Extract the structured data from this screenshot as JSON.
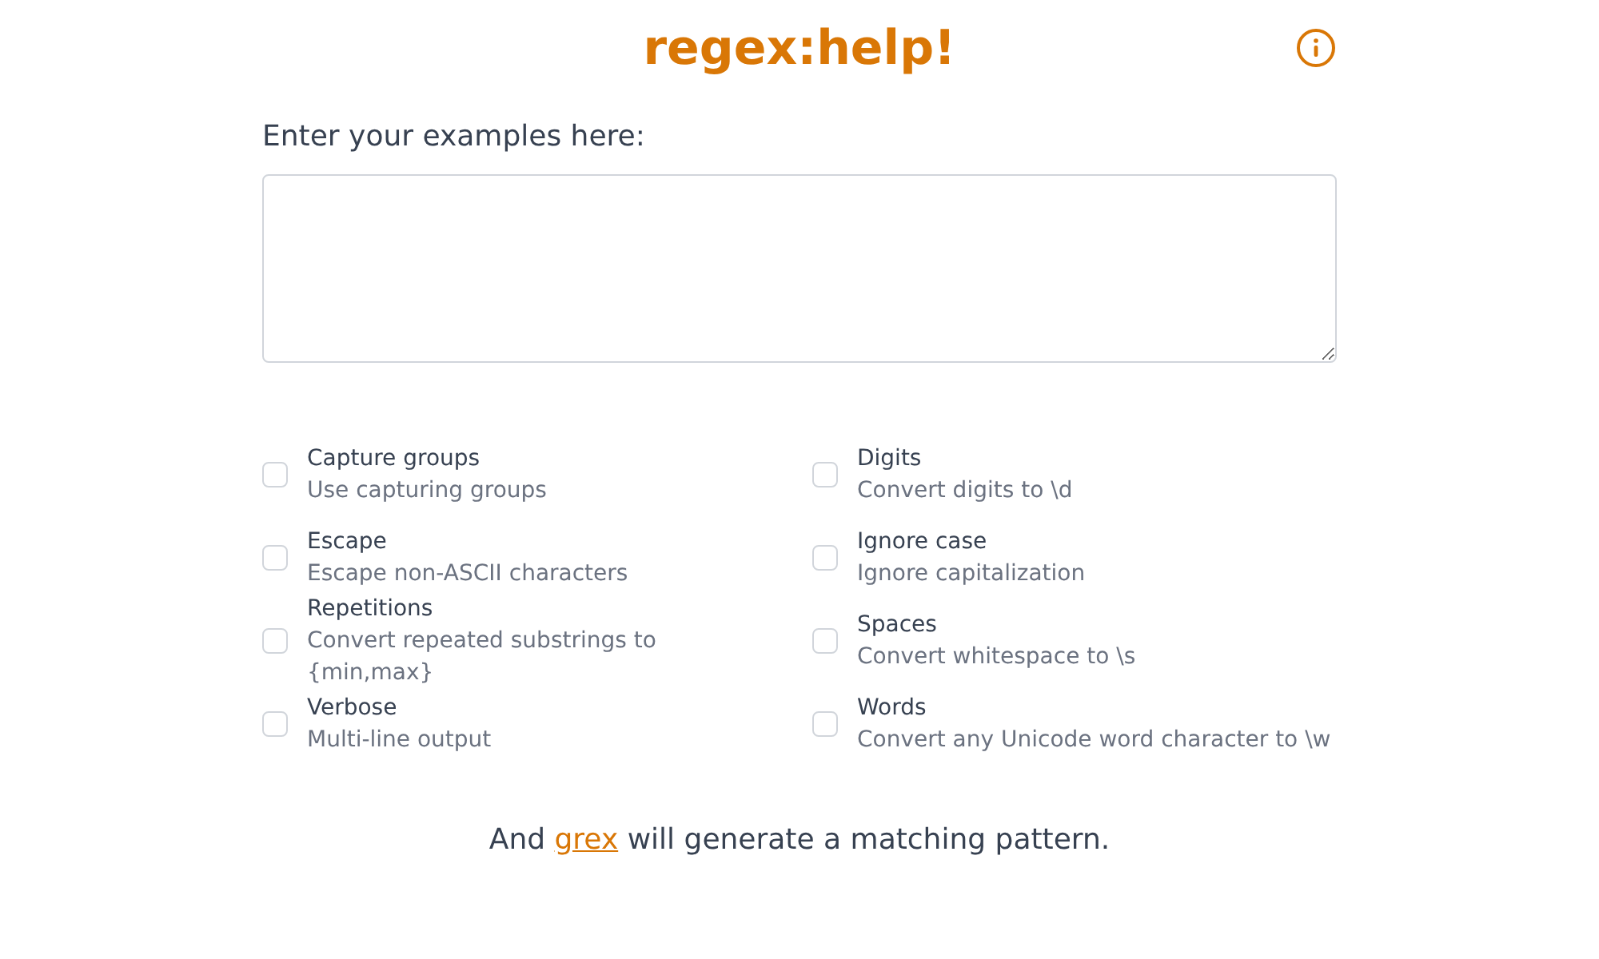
{
  "title": "regex:help!",
  "examples": {
    "label": "Enter your examples here:"
  },
  "options": [
    {
      "label": "Capture groups",
      "description": "Use capturing groups",
      "checked": false
    },
    {
      "label": "Digits",
      "description": "Convert digits to \\d",
      "checked": false
    },
    {
      "label": "Escape",
      "description": "Escape non-ASCII characters",
      "checked": false
    },
    {
      "label": "Ignore case",
      "description": "Ignore capitalization",
      "checked": false
    },
    {
      "label": "Repetitions",
      "description": "Convert repeated substrings to {min,max}",
      "checked": false
    },
    {
      "label": "Spaces",
      "description": "Convert whitespace to \\s",
      "checked": false
    },
    {
      "label": "Verbose",
      "description": "Multi-line output",
      "checked": false
    },
    {
      "label": "Words",
      "description": "Convert any Unicode word character to \\w",
      "checked": false
    }
  ],
  "footer": {
    "before": "And ",
    "link": "grex",
    "after": " will generate a matching pattern."
  }
}
